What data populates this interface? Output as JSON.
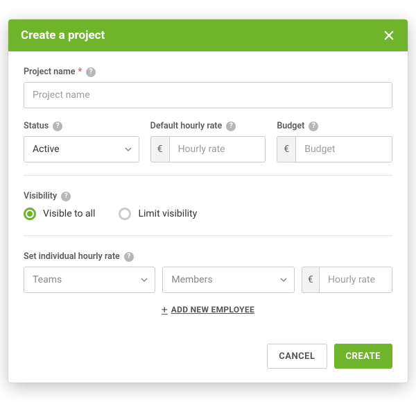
{
  "header": {
    "title": "Create a project"
  },
  "projectName": {
    "label": "Project name",
    "required": "*",
    "placeholder": "Project name"
  },
  "status": {
    "label": "Status",
    "value": "Active"
  },
  "hourlyRate": {
    "label": "Default hourly rate",
    "currency": "€",
    "placeholder": "Hourly rate"
  },
  "budget": {
    "label": "Budget",
    "currency": "€",
    "placeholder": "Budget"
  },
  "visibility": {
    "label": "Visibility",
    "options": {
      "all": "Visible to all",
      "limit": "Limit visibility"
    },
    "selected": "all"
  },
  "individualRate": {
    "label": "Set individual hourly rate",
    "teamsPlaceholder": "Teams",
    "membersPlaceholder": "Members",
    "currency": "€",
    "ratePlaceholder": "Hourly rate",
    "addLabel": "Add new employee"
  },
  "footer": {
    "cancel": "CANCEL",
    "create": "CREATE"
  }
}
